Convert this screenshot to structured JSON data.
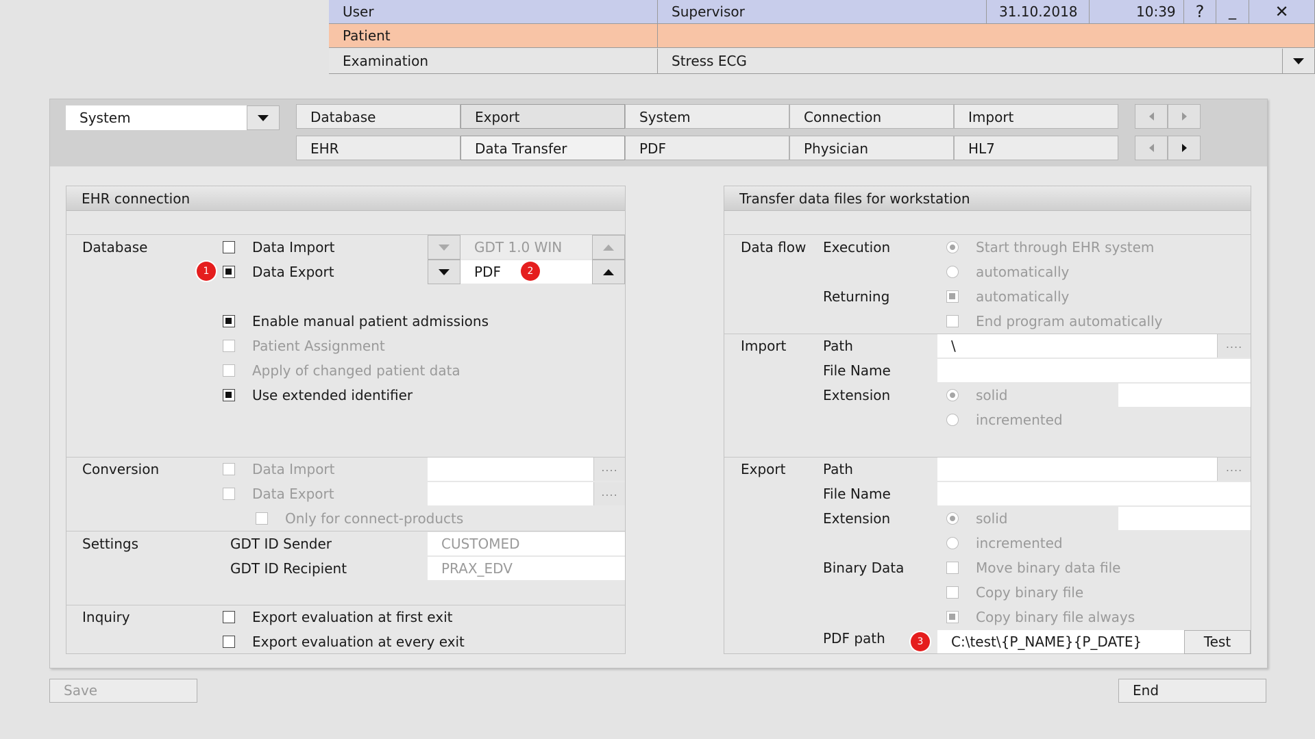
{
  "header": {
    "user_label": "User",
    "user_value": "Supervisor",
    "date": "31.10.2018",
    "time": "10:39",
    "help_symbol": "?",
    "minimize_symbol": "_",
    "close_symbol": "✕",
    "patient_label": "Patient",
    "patient_value": "",
    "examination_label": "Examination",
    "examination_value": "Stress ECG"
  },
  "toolbar": {
    "category_selected": "System",
    "tabs_row1": [
      "Database",
      "Export",
      "System",
      "Connection",
      "Import"
    ],
    "tabs_row2": [
      "EHR",
      "Data Transfer",
      "PDF",
      "Physician",
      "HL7"
    ],
    "active_row1": "Export",
    "active_row2": "Data Transfer"
  },
  "left": {
    "title": "EHR connection",
    "database": {
      "label": "Database",
      "data_import": "Data Import",
      "data_import_format": "GDT 1.0 WIN",
      "data_export": "Data Export",
      "data_export_format": "PDF",
      "enable_manual": "Enable manual patient admissions",
      "patient_assignment": "Patient Assignment",
      "apply_changed": "Apply of changed patient data",
      "use_extended": "Use extended identifier"
    },
    "conversion": {
      "label": "Conversion",
      "data_import": "Data Import",
      "data_export": "Data Export",
      "only_connect": "Only for connect-products"
    },
    "settings": {
      "label": "Settings",
      "sender_label": "GDT ID Sender",
      "sender_value": "CUSTOMED",
      "recipient_label": "GDT ID Recipient",
      "recipient_value": "PRAX_EDV"
    },
    "inquiry": {
      "label": "Inquiry",
      "first_exit": "Export evaluation at first exit",
      "every_exit": "Export evaluation at every exit"
    }
  },
  "right": {
    "title": "Transfer data files for workstation",
    "dataflow": {
      "label": "Data flow",
      "execution": "Execution",
      "start_through": "Start through EHR system",
      "automatically": "automatically",
      "returning": "Returning",
      "returning_auto": "automatically",
      "end_program": "End program automatically"
    },
    "import": {
      "label": "Import",
      "path": "Path",
      "path_value": "\\",
      "file_name": "File Name",
      "extension": "Extension",
      "solid": "solid",
      "incremented": "incremented"
    },
    "export": {
      "label": "Export",
      "path": "Path",
      "file_name": "File Name",
      "extension": "Extension",
      "solid": "solid",
      "incremented": "incremented",
      "binary_data": "Binary Data",
      "move_binary": "Move binary data file",
      "copy_binary": "Copy binary file",
      "copy_always": "Copy binary file always",
      "pdf_path": "PDF path",
      "pdf_path_value": "C:\\test\\{P_NAME}{P_DATE}",
      "test_button": "Test"
    }
  },
  "footer": {
    "save": "Save",
    "end": "End"
  },
  "badges": [
    "1",
    "2",
    "3"
  ],
  "dots": "....",
  "colors": {
    "user_row": "#c8cdeb",
    "patient_row": "#f8c4a6",
    "badge": "#e51e1e"
  }
}
